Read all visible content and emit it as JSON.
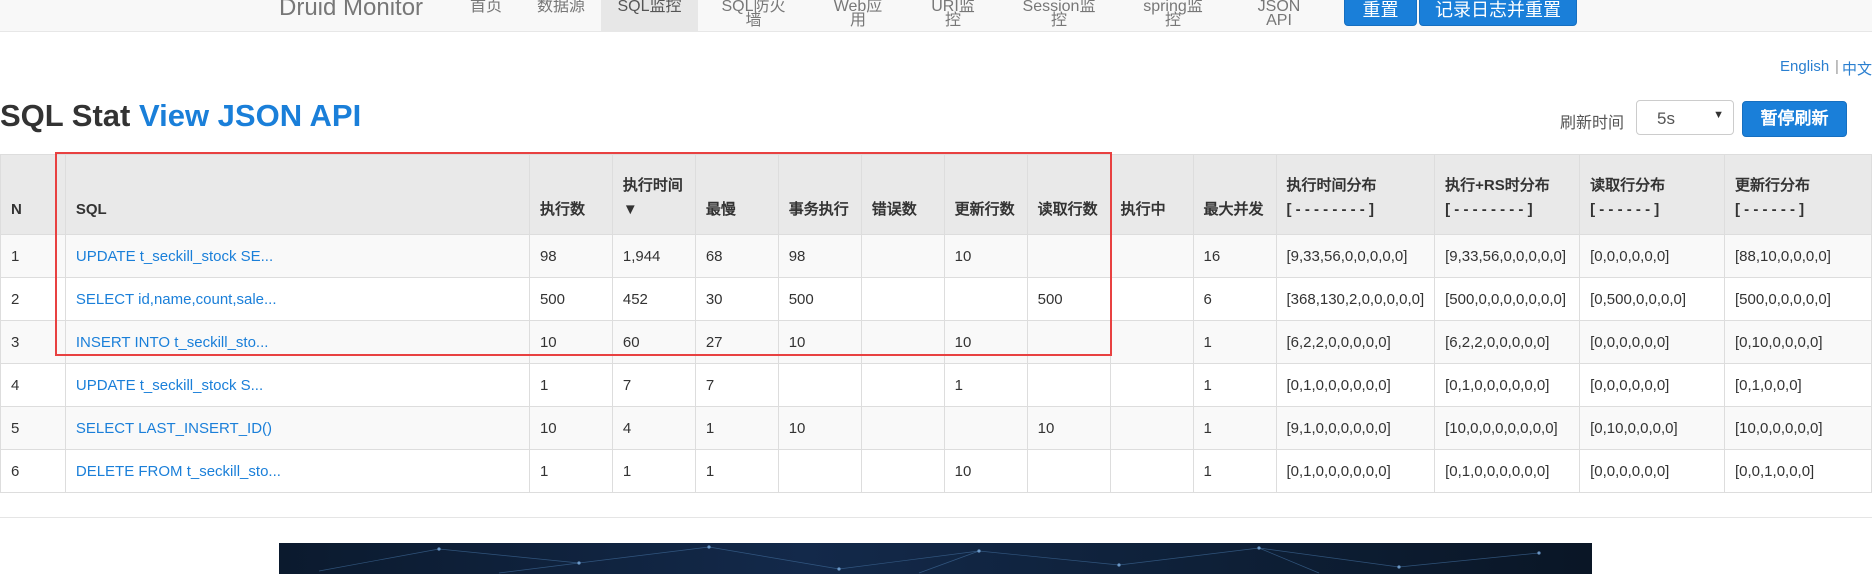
{
  "navbar": {
    "brand": "Druid Monitor",
    "items": [
      "首页",
      "数据源",
      "SQL监控",
      "SQL防火墙",
      "Web应用",
      "URI监控",
      "Session监控",
      "spring监控",
      "JSON API"
    ],
    "active_index": 2,
    "reset_label": "重置",
    "log_reset_label": "记录日志并重置"
  },
  "lang": {
    "english": "English",
    "separator": "|",
    "chinese": "中文"
  },
  "header": {
    "title": "SQL Stat",
    "title_link": "View JSON API",
    "refresh_label": "刷新时间",
    "refresh_value": "5s",
    "pause_label": "暂停刷新"
  },
  "table": {
    "columns": [
      [
        "N"
      ],
      [
        "SQL"
      ],
      [
        "执行数"
      ],
      [
        "执行时间",
        "▼"
      ],
      [
        "最慢"
      ],
      [
        "事务执行"
      ],
      [
        "错误数"
      ],
      [
        "更新行数"
      ],
      [
        "读取行数"
      ],
      [
        "执行中"
      ],
      [
        "最大并发"
      ],
      [
        "执行时间分布",
        "[ - - - - - - - - ]"
      ],
      [
        "执行+RS时分布",
        "[ - - - - - - - - ]"
      ],
      [
        "读取行分布",
        "[ - - - - - - ]"
      ],
      [
        "更新行分布",
        "[ - - - - - - ]"
      ]
    ],
    "rows": [
      [
        "1",
        "UPDATE t_seckill_stock SE...",
        "98",
        "1,944",
        "68",
        "98",
        "",
        "10",
        "",
        "",
        "16",
        "[9,33,56,0,0,0,0,0]",
        "[9,33,56,0,0,0,0,0]",
        "[0,0,0,0,0,0]",
        "[88,10,0,0,0,0]"
      ],
      [
        "2",
        "SELECT id,name,count,sale...",
        "500",
        "452",
        "30",
        "500",
        "",
        "",
        "500",
        "",
        "6",
        "[368,130,2,0,0,0,0,0]",
        "[500,0,0,0,0,0,0,0]",
        "[0,500,0,0,0,0]",
        "[500,0,0,0,0,0]"
      ],
      [
        "3",
        "INSERT INTO t_seckill_sto...",
        "10",
        "60",
        "27",
        "10",
        "",
        "10",
        "",
        "",
        "1",
        "[6,2,2,0,0,0,0,0]",
        "[6,2,2,0,0,0,0,0]",
        "[0,0,0,0,0,0]",
        "[0,10,0,0,0,0]"
      ],
      [
        "4",
        "UPDATE t_seckill_stock S...",
        "1",
        "7",
        "7",
        "",
        "",
        "1",
        "",
        "",
        "1",
        "[0,1,0,0,0,0,0,0]",
        "[0,1,0,0,0,0,0,0]",
        "[0,0,0,0,0,0]",
        "[0,1,0,0,0]"
      ],
      [
        "5",
        "SELECT LAST_INSERT_ID()",
        "10",
        "4",
        "1",
        "10",
        "",
        "",
        "10",
        "",
        "1",
        "[9,1,0,0,0,0,0,0]",
        "[10,0,0,0,0,0,0,0]",
        "[0,10,0,0,0,0]",
        "[10,0,0,0,0,0]"
      ],
      [
        "6",
        "DELETE FROM t_seckill_sto...",
        "1",
        "1",
        "1",
        "",
        "",
        "10",
        "",
        "",
        "1",
        "[0,1,0,0,0,0,0,0]",
        "[0,1,0,0,0,0,0,0]",
        "[0,0,0,0,0,0]",
        "[0,0,1,0,0,0]"
      ]
    ]
  },
  "colors": {
    "accent": "#1a7fd9",
    "highlight_box": "#e84141",
    "header_bg": "#e9e9e9"
  }
}
